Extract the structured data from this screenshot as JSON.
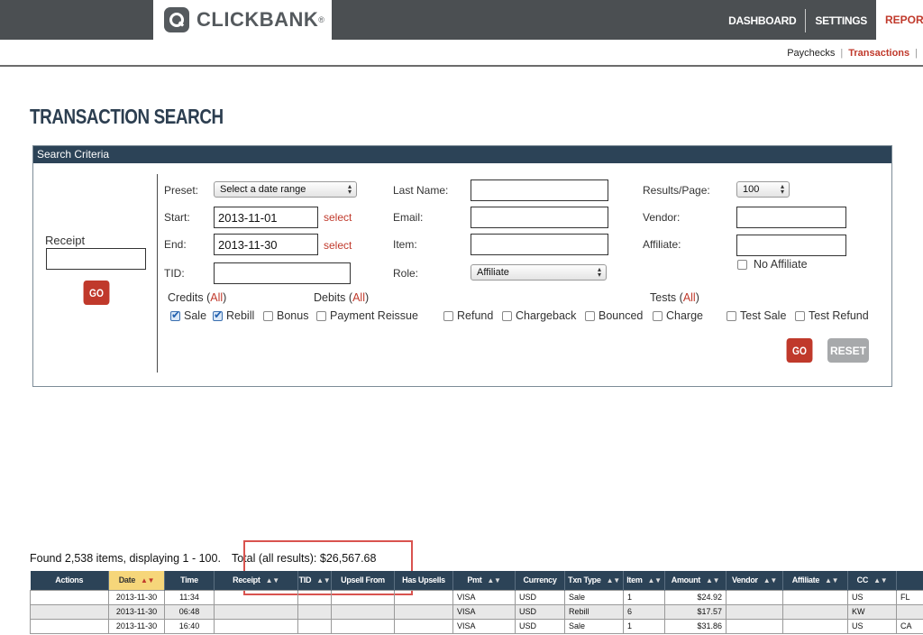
{
  "header": {
    "logo_text": "CLICKBANK",
    "logo_reg": "®",
    "nav": [
      "DASHBOARD",
      "SETTINGS"
    ],
    "nav_active": "REPORT",
    "subnav": [
      "Paychecks",
      "Transactions"
    ]
  },
  "page_title": "TRANSACTION SEARCH",
  "criteria": {
    "header": "Search Criteria",
    "receipt_label": "Receipt",
    "receipt_value": "",
    "go_label": "GO",
    "reset_label": "RESET",
    "preset_label": "Preset:",
    "preset_value": "Select a date range",
    "start_label": "Start:",
    "start_value": "2013-11-01",
    "end_label": "End:",
    "end_value": "2013-11-30",
    "select_link": "select",
    "tid_label": "TID:",
    "last_name_label": "Last Name:",
    "email_label": "Email:",
    "item_label": "Item:",
    "role_label": "Role:",
    "role_value": "Affiliate",
    "results_label": "Results/Page:",
    "results_value": "100",
    "vendor_label": "Vendor:",
    "affiliate_label": "Affiliate:",
    "no_affiliate_label": "No Affiliate",
    "credits_label": "Credits (",
    "debits_label": "Debits (",
    "tests_label": "Tests (",
    "all_label": "All",
    "close_paren": ")",
    "checkboxes": {
      "sale": "Sale",
      "rebill": "Rebill",
      "bonus": "Bonus",
      "payment_reissue": "Payment Reissue",
      "refund": "Refund",
      "chargeback": "Chargeback",
      "bounced": "Bounced",
      "charge": "Charge",
      "test_sale": "Test Sale",
      "test_refund": "Test Refund"
    }
  },
  "summary": {
    "found": "Found 2,538 items, displaying 1 - 100.",
    "total": "Total (all results): $26,567.68"
  },
  "table": {
    "columns": [
      "Actions",
      "Date",
      "Time",
      "Receipt",
      "TID",
      "Upsell From",
      "Has Upsells",
      "Pmt",
      "Currency",
      "Txn Type",
      "Item",
      "Amount",
      "Vendor",
      "Affiliate",
      "CC",
      ""
    ],
    "sort_glyph": "▲▼",
    "rows": [
      [
        "",
        "2013-11-30",
        "11:34",
        "",
        "",
        "",
        "",
        "VISA",
        "USD",
        "Sale",
        "1",
        "$24.92",
        "",
        "",
        "US",
        "FL"
      ],
      [
        "",
        "2013-11-30",
        "06:48",
        "",
        "",
        "",
        "",
        "VISA",
        "USD",
        "Rebill",
        "6",
        "$17.57",
        "",
        "",
        "KW",
        ""
      ],
      [
        "",
        "2013-11-30",
        "16:40",
        "",
        "",
        "",
        "",
        "VISA",
        "USD",
        "Sale",
        "1",
        "$31.86",
        "",
        "",
        "US",
        "CA"
      ]
    ]
  }
}
